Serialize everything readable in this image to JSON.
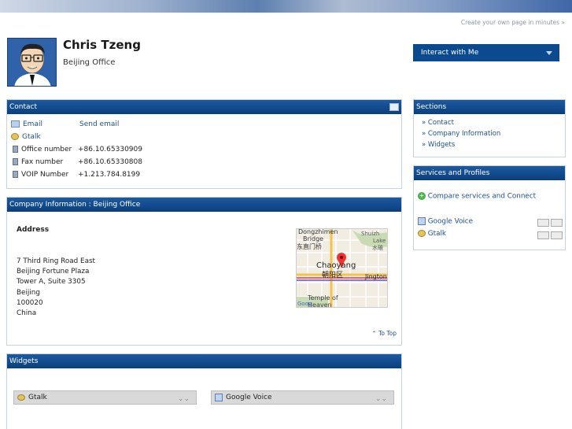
{
  "header": {
    "create_link": "Create your own page in minutes »"
  },
  "profile": {
    "name": "Chris Tzeng",
    "office": "Beijing Office"
  },
  "interact": {
    "label": "Interact with Me"
  },
  "contact": {
    "title": "Contact",
    "rows": [
      {
        "label": "Email",
        "value": "Send email",
        "icon": "email-icon"
      },
      {
        "label": "Gtalk",
        "value": "",
        "icon": "gtalk-icon"
      },
      {
        "label": "Office number",
        "value": "+86.10.65330909",
        "icon": "phone-icon"
      },
      {
        "label": "Fax number",
        "value": "+86.10.65330808",
        "icon": "phone-icon"
      },
      {
        "label": "VOIP Number",
        "value": "+1.213.784.8199",
        "icon": "phone-icon"
      }
    ]
  },
  "company": {
    "title": "Company Information : Beijing Office",
    "address_heading": "Address",
    "address_lines": [
      "7 Third Ring Road East",
      "Beijing Fortune Plaza",
      "Tower A, Suite 3305",
      "Beijing",
      "100020",
      "China"
    ],
    "to_top": "To Top",
    "map_labels": {
      "place": "Chaoyang",
      "place_cn": "朝阳区",
      "bridge": "Bridge",
      "bridge_cn": "东直门桥",
      "east": "Jington",
      "temple": "Temple of",
      "heaven": "Heaven",
      "north1": "Shuizh",
      "north2": "Lake",
      "north3": "水碓",
      "north_top": "Dongzhimen",
      "watermark": "Goog"
    }
  },
  "widgets": {
    "title": "Widgets",
    "items": [
      {
        "label": "Gtalk"
      },
      {
        "label": "Google Voice"
      }
    ]
  },
  "sections": {
    "title": "Sections",
    "items": [
      "» Contact",
      "» Company Information",
      "» Widgets"
    ]
  },
  "services": {
    "title": "Services and Profiles",
    "compare": "Compare services and Connect",
    "items": [
      "Google Voice",
      "Gtalk"
    ]
  },
  "colors": {
    "accent": "#0b4a8f",
    "link": "#1d4f93"
  }
}
